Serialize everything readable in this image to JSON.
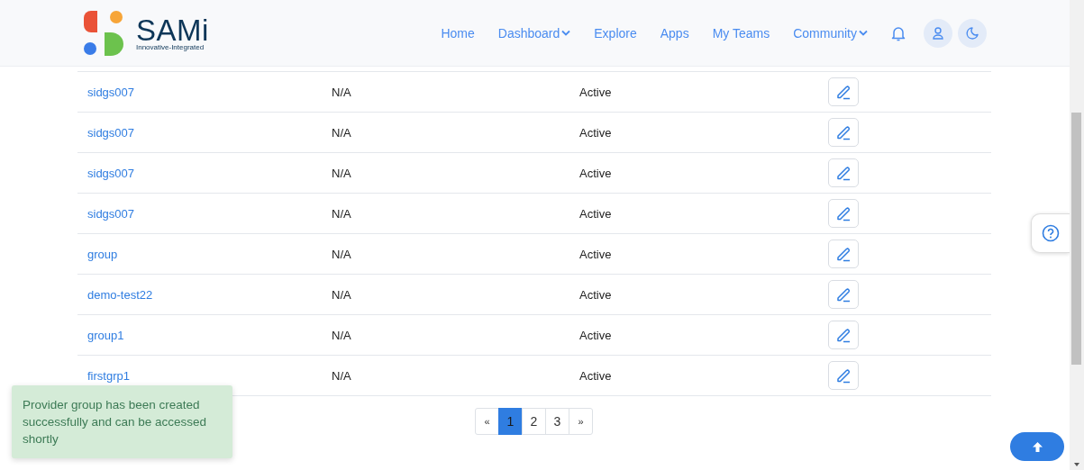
{
  "logo": {
    "name": "SAMi",
    "tagline": "Innovative-Integrated"
  },
  "nav": [
    {
      "label": "Home",
      "kind": "link"
    },
    {
      "label": "Dashboard",
      "kind": "dropdown"
    },
    {
      "label": "Explore",
      "kind": "link"
    },
    {
      "label": "Apps",
      "kind": "link"
    },
    {
      "label": "My Teams",
      "kind": "link"
    },
    {
      "label": "Community",
      "kind": "dropdown"
    }
  ],
  "rows": [
    {
      "name": "sidgs007",
      "column_2": "N/A",
      "status": "Active"
    },
    {
      "name": "sidgs007",
      "column_2": "N/A",
      "status": "Active"
    },
    {
      "name": "sidgs007",
      "column_2": "N/A",
      "status": "Active"
    },
    {
      "name": "sidgs007",
      "column_2": "N/A",
      "status": "Active"
    },
    {
      "name": "group",
      "column_2": "N/A",
      "status": "Active"
    },
    {
      "name": "demo-test22",
      "column_2": "N/A",
      "status": "Active"
    },
    {
      "name": "group1",
      "column_2": "N/A",
      "status": "Active"
    },
    {
      "name": "firstgrp1",
      "column_2": "N/A",
      "status": "Active"
    }
  ],
  "pagination": {
    "previous": "«",
    "next": "»",
    "pages": [
      {
        "label": "1",
        "selected": true
      },
      {
        "label": "2",
        "selected": false
      },
      {
        "label": "3",
        "selected": false
      }
    ]
  },
  "toast": {
    "message": "Provider group has been created successfully and can be accessed shortly"
  }
}
